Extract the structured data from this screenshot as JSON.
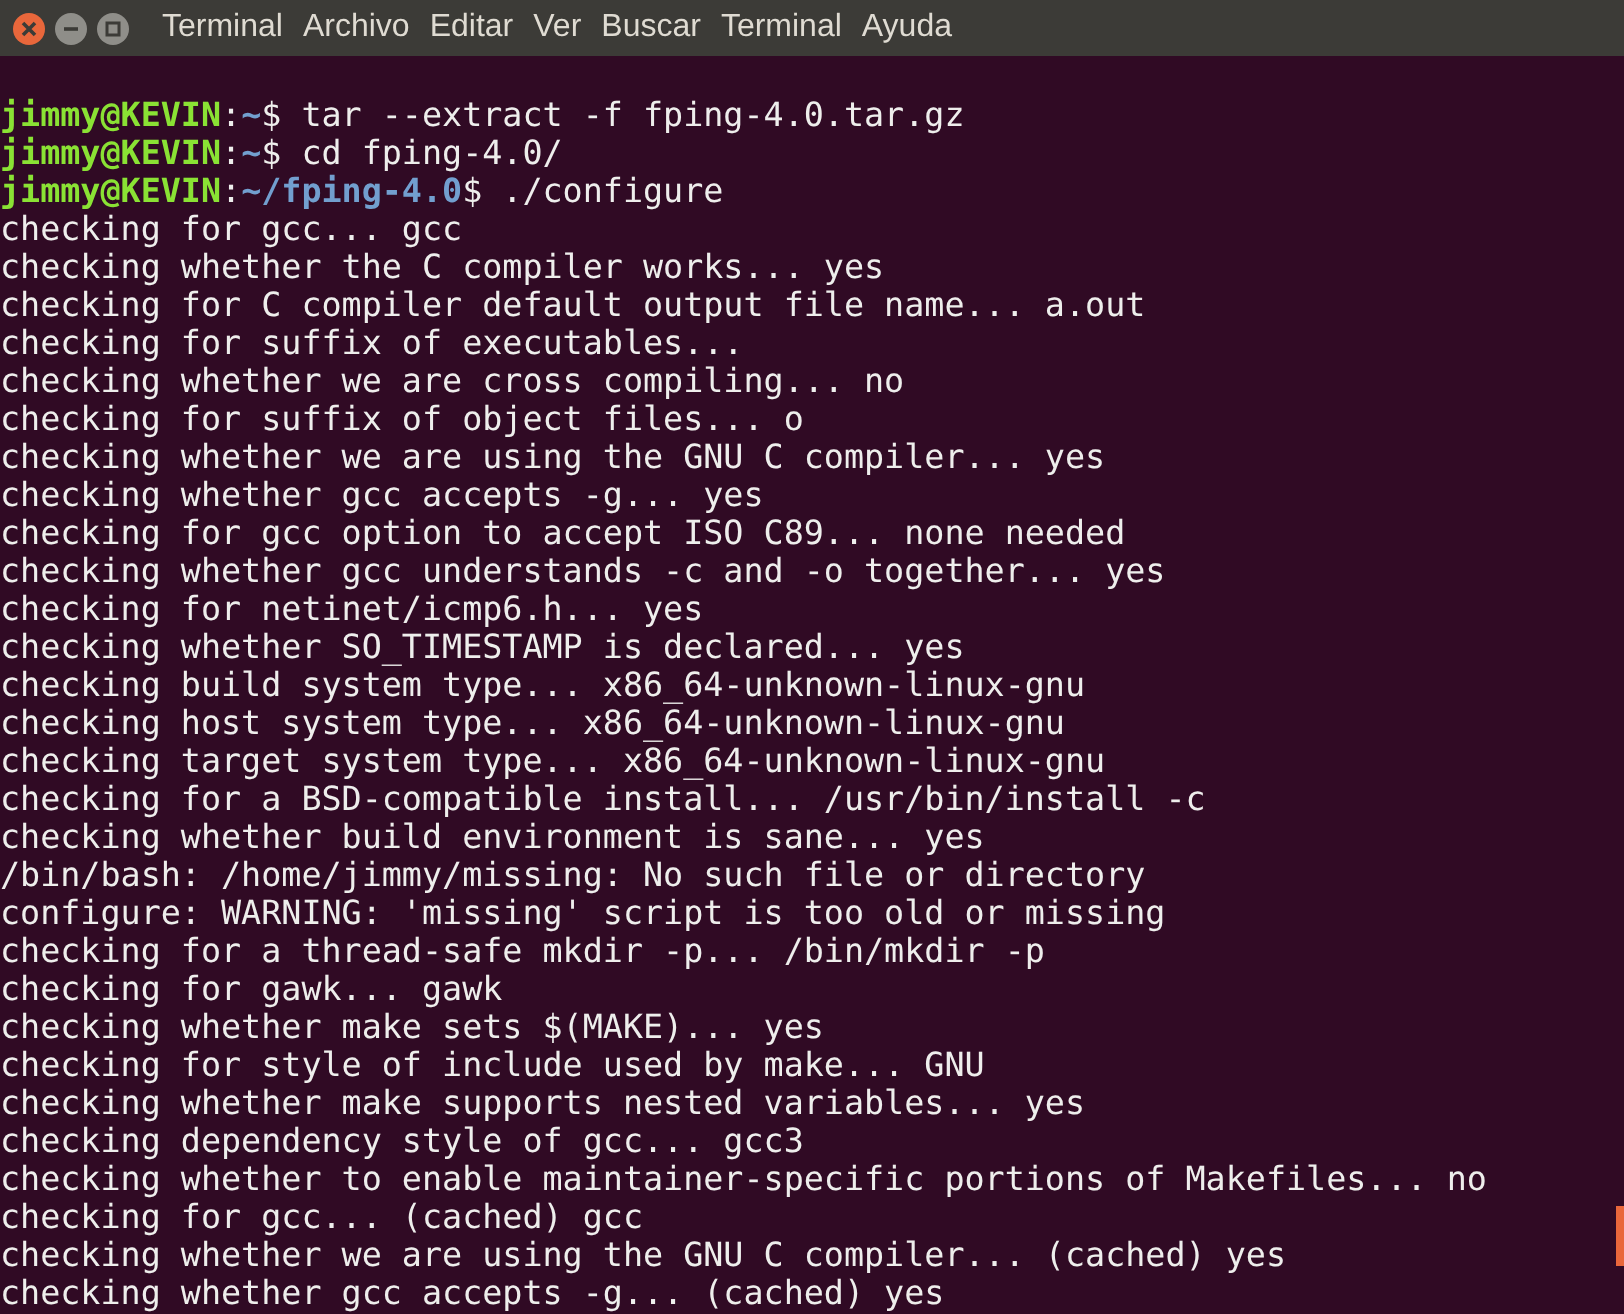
{
  "menu_bar": {
    "items": [
      "Terminal",
      "Archivo",
      "Editar",
      "Ver",
      "Buscar",
      "Terminal",
      "Ayuda"
    ]
  },
  "terminal": {
    "lines": [
      {
        "kind": "prompt",
        "user": "jimmy@KEVIN",
        "separator": ":",
        "path": "~",
        "command": "$ tar --extract -f fping-4.0.tar.gz"
      },
      {
        "kind": "prompt",
        "user": "jimmy@KEVIN",
        "separator": ":",
        "path": "~",
        "command": "$ cd fping-4.0/"
      },
      {
        "kind": "prompt",
        "user": "jimmy@KEVIN",
        "separator": ":",
        "path": "~/fping-4.0",
        "command": "$ ./configure"
      },
      {
        "kind": "output",
        "text": "checking for gcc... gcc"
      },
      {
        "kind": "output",
        "text": "checking whether the C compiler works... yes"
      },
      {
        "kind": "output",
        "text": "checking for C compiler default output file name... a.out"
      },
      {
        "kind": "output",
        "text": "checking for suffix of executables..."
      },
      {
        "kind": "output",
        "text": "checking whether we are cross compiling... no"
      },
      {
        "kind": "output",
        "text": "checking for suffix of object files... o"
      },
      {
        "kind": "output",
        "text": "checking whether we are using the GNU C compiler... yes"
      },
      {
        "kind": "output",
        "text": "checking whether gcc accepts -g... yes"
      },
      {
        "kind": "output",
        "text": "checking for gcc option to accept ISO C89... none needed"
      },
      {
        "kind": "output",
        "text": "checking whether gcc understands -c and -o together... yes"
      },
      {
        "kind": "output",
        "text": "checking for netinet/icmp6.h... yes"
      },
      {
        "kind": "output",
        "text": "checking whether SO_TIMESTAMP is declared... yes"
      },
      {
        "kind": "output",
        "text": "checking build system type... x86_64-unknown-linux-gnu"
      },
      {
        "kind": "output",
        "text": "checking host system type... x86_64-unknown-linux-gnu"
      },
      {
        "kind": "output",
        "text": "checking target system type... x86_64-unknown-linux-gnu"
      },
      {
        "kind": "output",
        "text": "checking for a BSD-compatible install... /usr/bin/install -c"
      },
      {
        "kind": "output",
        "text": "checking whether build environment is sane... yes"
      },
      {
        "kind": "output",
        "text": "/bin/bash: /home/jimmy/missing: No such file or directory"
      },
      {
        "kind": "output",
        "text": "configure: WARNING: 'missing' script is too old or missing"
      },
      {
        "kind": "output",
        "text": "checking for a thread-safe mkdir -p... /bin/mkdir -p"
      },
      {
        "kind": "output",
        "text": "checking for gawk... gawk"
      },
      {
        "kind": "output",
        "text": "checking whether make sets $(MAKE)... yes"
      },
      {
        "kind": "output",
        "text": "checking for style of include used by make... GNU"
      },
      {
        "kind": "output",
        "text": "checking whether make supports nested variables... yes"
      },
      {
        "kind": "output",
        "text": "checking dependency style of gcc... gcc3"
      },
      {
        "kind": "output",
        "text": "checking whether to enable maintainer-specific portions of Makefiles... no"
      },
      {
        "kind": "output",
        "text": "checking for gcc... (cached) gcc"
      },
      {
        "kind": "output",
        "text": "checking whether we are using the GNU C compiler... (cached) yes"
      },
      {
        "kind": "output",
        "text": "checking whether gcc accepts -g... (cached) yes"
      }
    ]
  }
}
